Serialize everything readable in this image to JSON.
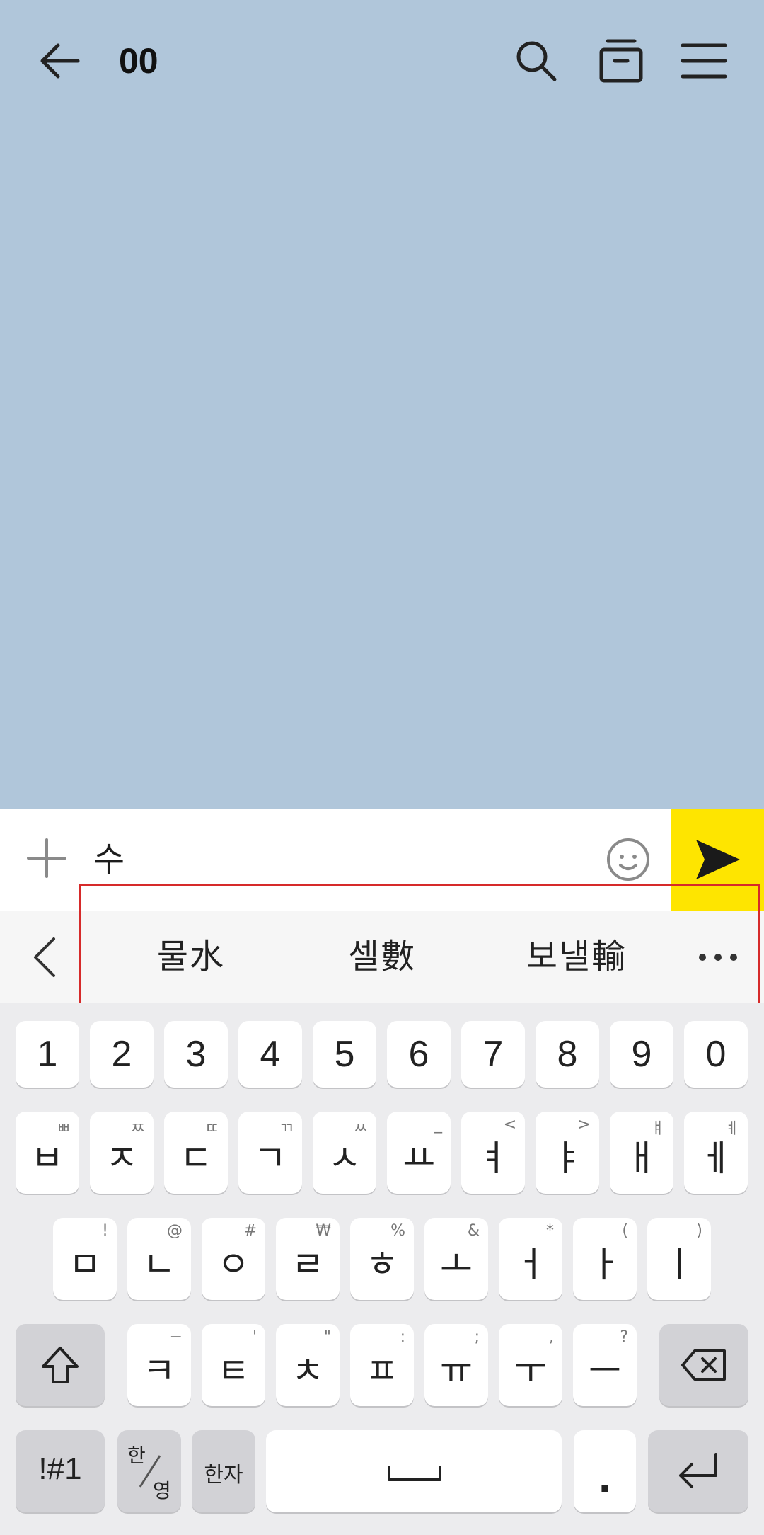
{
  "header": {
    "title": "00"
  },
  "input": {
    "value": "수"
  },
  "suggestions": {
    "items": [
      "물水",
      "셀數",
      "보낼輸"
    ]
  },
  "keyboard": {
    "row_numbers": [
      "1",
      "2",
      "3",
      "4",
      "5",
      "6",
      "7",
      "8",
      "9",
      "0"
    ],
    "row1": [
      {
        "main": "ㅂ",
        "sub": "ㅃ"
      },
      {
        "main": "ㅈ",
        "sub": "ㅉ"
      },
      {
        "main": "ㄷ",
        "sub": "ㄸ"
      },
      {
        "main": "ㄱ",
        "sub": "ㄲ"
      },
      {
        "main": "ㅅ",
        "sub": "ㅆ"
      },
      {
        "main": "ㅛ",
        "sub": "_"
      },
      {
        "main": "ㅕ",
        "sub": "<"
      },
      {
        "main": "ㅑ",
        "sub": ">"
      },
      {
        "main": "ㅐ",
        "sub": "ㅒ"
      },
      {
        "main": "ㅔ",
        "sub": "ㅖ"
      }
    ],
    "row2": [
      {
        "main": "ㅁ",
        "sub": "!"
      },
      {
        "main": "ㄴ",
        "sub": "@"
      },
      {
        "main": "ㅇ",
        "sub": "#"
      },
      {
        "main": "ㄹ",
        "sub": "₩"
      },
      {
        "main": "ㅎ",
        "sub": "%"
      },
      {
        "main": "ㅗ",
        "sub": "&"
      },
      {
        "main": "ㅓ",
        "sub": "*"
      },
      {
        "main": "ㅏ",
        "sub": "("
      },
      {
        "main": "ㅣ",
        "sub": ")"
      }
    ],
    "row3": [
      {
        "main": "ㅋ",
        "sub": "−"
      },
      {
        "main": "ㅌ",
        "sub": "'"
      },
      {
        "main": "ㅊ",
        "sub": "\""
      },
      {
        "main": "ㅍ",
        "sub": ":"
      },
      {
        "main": "ㅠ",
        "sub": ";"
      },
      {
        "main": "ㅜ",
        "sub": ","
      },
      {
        "main": "ㅡ",
        "sub": "?"
      }
    ],
    "symbols_label": "!#1",
    "lang_top": "한",
    "lang_bottom": "영",
    "hanja_label": "한자",
    "period_label": "."
  },
  "colors": {
    "chat_background": "#b0c6da",
    "send_button": "#fee500",
    "highlight_border": "#d62a2a"
  },
  "icons": [
    "back-arrow-icon",
    "search-icon",
    "archive-box-icon",
    "menu-icon",
    "plus-icon",
    "emoji-icon",
    "send-icon",
    "chevron-left-icon",
    "more-dots-icon",
    "shift-icon",
    "backspace-icon",
    "space-icon",
    "enter-icon"
  ]
}
